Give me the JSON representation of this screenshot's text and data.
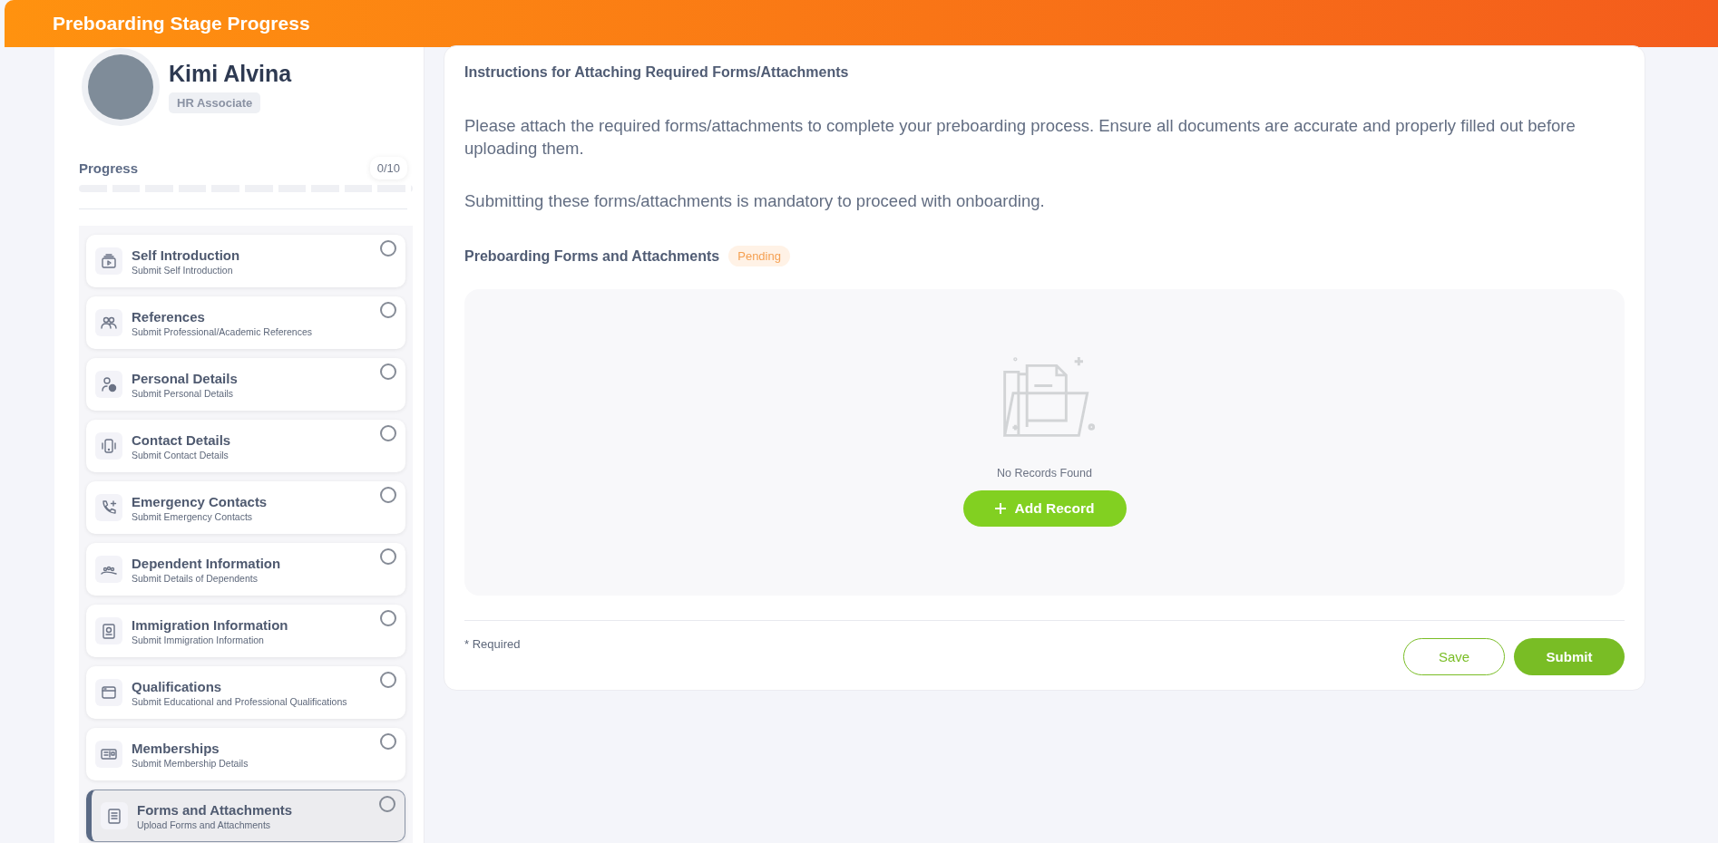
{
  "header": {
    "title": "Preboarding Stage Progress"
  },
  "profile": {
    "name": "Kimi Alvina",
    "role": "HR Associate"
  },
  "progress": {
    "label": "Progress",
    "count": "0/10",
    "level": 0
  },
  "steps": [
    {
      "title": "Self Introduction",
      "subtitle": "Submit Self Introduction",
      "checked": false,
      "selected": false
    },
    {
      "title": "References",
      "subtitle": "Submit Professional/Academic References",
      "checked": false,
      "selected": false
    },
    {
      "title": "Personal Details",
      "subtitle": "Submit Personal Details",
      "checked": false,
      "selected": false
    },
    {
      "title": "Contact Details",
      "subtitle": "Submit Contact Details",
      "checked": false,
      "selected": false
    },
    {
      "title": "Emergency Contacts",
      "subtitle": "Submit Emergency Contacts",
      "checked": false,
      "selected": false
    },
    {
      "title": "Dependent Information",
      "subtitle": "Submit Details of Dependents",
      "checked": false,
      "selected": false
    },
    {
      "title": "Immigration Information",
      "subtitle": "Submit Immigration Information",
      "checked": false,
      "selected": false
    },
    {
      "title": "Qualifications",
      "subtitle": "Submit Educational and Professional Qualifications",
      "checked": false,
      "selected": false
    },
    {
      "title": "Memberships",
      "subtitle": "Submit Membership Details",
      "checked": false,
      "selected": false
    },
    {
      "title": "Forms and Attachments",
      "subtitle": "Upload Forms and Attachments",
      "checked": false,
      "selected": true
    }
  ],
  "main": {
    "instructions_title": "Instructions for Attaching Required Forms/Attachments",
    "paragraphs": [
      "Please attach the required forms/attachments to complete your preboarding process. Ensure all documents are accurate and properly filled out before uploading them.",
      "Submitting these forms/attachments is mandatory to proceed with onboarding."
    ],
    "section_title": "Preboarding Forms and Attachments",
    "status": "Pending",
    "empty_message": "No Records Found",
    "add_button": "Add Record",
    "required_note": "* Required",
    "save_button": "Save",
    "submit_button": "Submit"
  }
}
